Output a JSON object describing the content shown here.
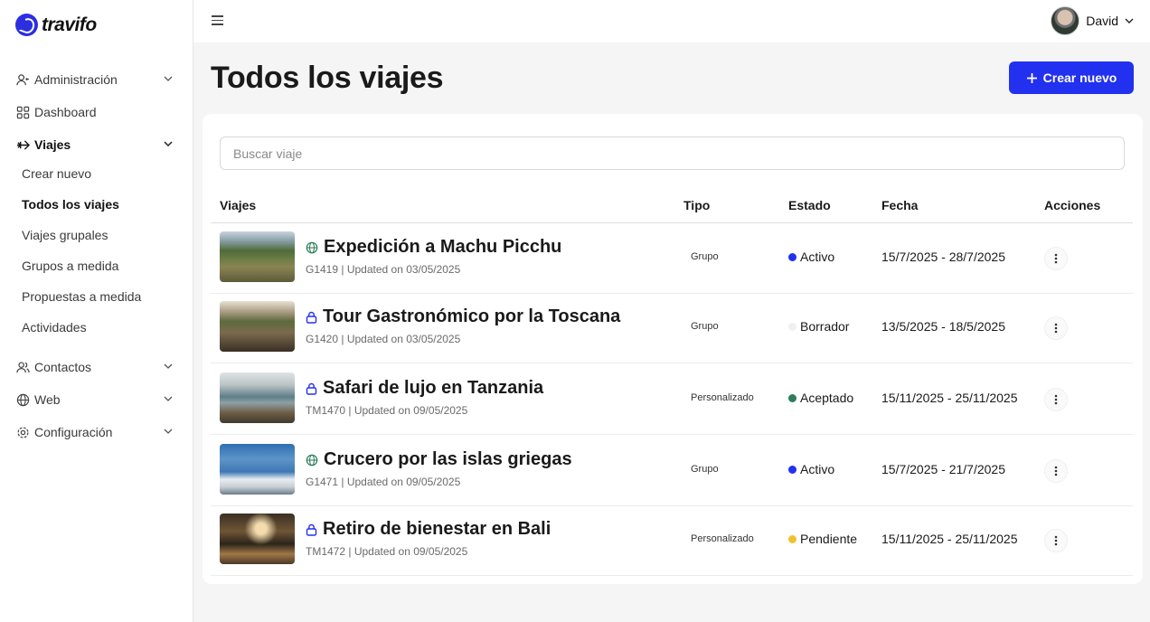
{
  "brand": {
    "name": "travifo",
    "accent": "#2230f0"
  },
  "sidebar": {
    "items": [
      {
        "label": "Administración",
        "icon": "user-admin-icon"
      },
      {
        "label": "Dashboard",
        "icon": "dashboard-grid-icon"
      },
      {
        "label": "Viajes",
        "icon": "plane-icon"
      },
      {
        "label": "Contactos",
        "icon": "users-icon"
      },
      {
        "label": "Web",
        "icon": "globe-icon"
      },
      {
        "label": "Configuración",
        "icon": "gear-icon"
      }
    ],
    "subitems": [
      {
        "label": "Crear nuevo"
      },
      {
        "label": "Todos los viajes"
      },
      {
        "label": "Viajes grupales"
      },
      {
        "label": "Grupos a medida"
      },
      {
        "label": "Propuestas a medida"
      },
      {
        "label": "Actividades"
      }
    ]
  },
  "header": {
    "user_name": "David"
  },
  "page": {
    "title": "Todos los viajes",
    "create_label": "Crear nuevo"
  },
  "search": {
    "placeholder": "Buscar viaje"
  },
  "table": {
    "headers": {
      "viajes": "Viajes",
      "tipo": "Tipo",
      "estado": "Estado",
      "fecha": "Fecha",
      "acciones": "Acciones"
    },
    "rows": [
      {
        "title": "Expedición a Machu Picchu",
        "visibility_icon": "globe-icon",
        "code": "G1419",
        "updated": "Updated on 03/05/2025",
        "tipo": "Grupo",
        "estado": "Activo",
        "estado_color": "#2230f0",
        "fecha": "15/7/2025 - 28/7/2025"
      },
      {
        "title": "Tour Gastronómico por la Toscana",
        "visibility_icon": "lock-icon",
        "code": "G1420",
        "updated": "Updated on 03/05/2025",
        "tipo": "Grupo",
        "estado": "Borrador",
        "estado_color": "#f0f0f0",
        "fecha": "13/5/2025 - 18/5/2025"
      },
      {
        "title": "Safari de lujo en Tanzania",
        "visibility_icon": "lock-icon",
        "code": "TM1470",
        "updated": "Updated on 09/05/2025",
        "tipo": "Personalizado",
        "estado": "Aceptado",
        "estado_color": "#2e7d5b",
        "fecha": "15/11/2025 - 25/11/2025"
      },
      {
        "title": "Crucero por las islas griegas",
        "visibility_icon": "globe-icon",
        "code": "G1471",
        "updated": "Updated on 09/05/2025",
        "tipo": "Grupo",
        "estado": "Activo",
        "estado_color": "#2230f0",
        "fecha": "15/7/2025 - 21/7/2025"
      },
      {
        "title": "Retiro de bienestar en Bali",
        "visibility_icon": "lock-icon",
        "code": "TM1472",
        "updated": "Updated on 09/05/2025",
        "tipo": "Personalizado",
        "estado": "Pendiente",
        "estado_color": "#f2c12e",
        "fecha": "15/11/2025 - 25/11/2025"
      }
    ]
  }
}
